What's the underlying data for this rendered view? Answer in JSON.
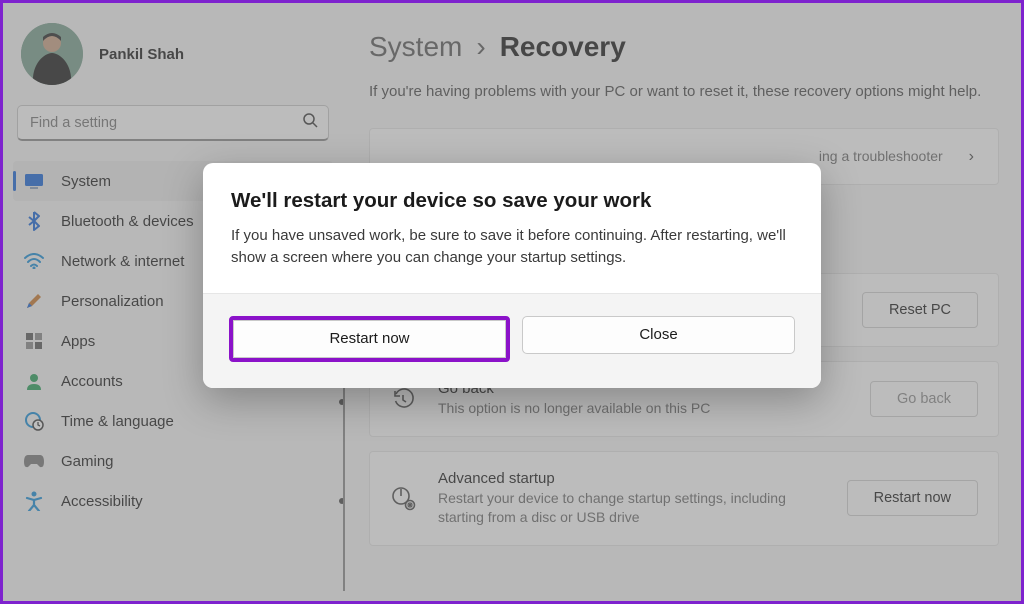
{
  "user": {
    "name": "Pankil Shah"
  },
  "search": {
    "placeholder": "Find a setting"
  },
  "nav": {
    "system": "System",
    "bluetooth": "Bluetooth & devices",
    "network": "Network & internet",
    "personalization": "Personalization",
    "apps": "Apps",
    "accounts": "Accounts",
    "time": "Time & language",
    "gaming": "Gaming",
    "accessibility": "Accessibility"
  },
  "breadcrumb": {
    "parent": "System",
    "sep": "›",
    "current": "Recovery"
  },
  "page_desc": "If you're having problems with your PC or want to reset it, these recovery options might help.",
  "cards": {
    "troubleshooter": {
      "title_suffix": "ing a troubleshooter"
    },
    "reset": {
      "button_label": "Reset PC"
    },
    "goback": {
      "title": "Go back",
      "desc": "This option is no longer available on this PC",
      "button_label": "Go back"
    },
    "advanced": {
      "title": "Advanced startup",
      "desc": "Restart your device to change startup settings, including starting from a disc or USB drive",
      "button_label": "Restart now"
    }
  },
  "dialog": {
    "title": "We'll restart your device so save your work",
    "text": "If you have unsaved work, be sure to save it before continuing. After restarting, we'll show a screen where you can change your startup settings.",
    "restart_label": "Restart now",
    "close_label": "Close"
  }
}
